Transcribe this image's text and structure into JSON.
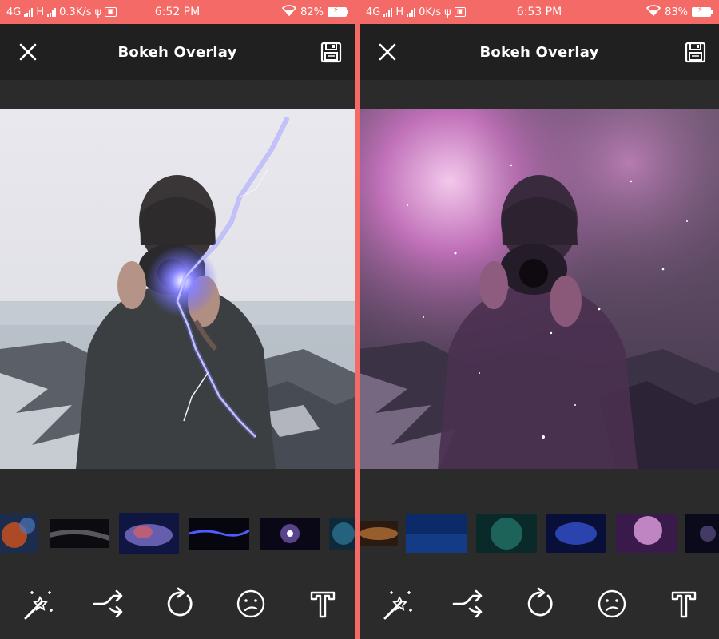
{
  "screens": [
    {
      "status": {
        "net": "4G",
        "net2": "H",
        "speed": "0.3K/s",
        "time": "6:52 PM",
        "battery": "82%"
      },
      "app": {
        "title": "Bokeh Overlay"
      },
      "overlay": "lightning"
    },
    {
      "status": {
        "net": "4G",
        "net2": "H",
        "speed": "0K/s",
        "time": "6:53 PM",
        "battery": "83%"
      },
      "app": {
        "title": "Bokeh Overlay"
      },
      "overlay": "nebula"
    }
  ],
  "thumbnails_left": [
    "orange-nebula",
    "dark-stars",
    "galaxy-blue",
    "blue-streak",
    "purple-galaxy",
    "teal-nebula"
  ],
  "thumbnails_right": [
    "amber-glow",
    "blue-sky-stars",
    "teal-nebula",
    "blue-nebula",
    "pink-nebula",
    "space-dark"
  ],
  "tools": [
    "magic-wand-icon",
    "shuffle-icon",
    "refresh-icon",
    "sad-face-icon",
    "text-icon"
  ],
  "colors": {
    "status_bar": "#f46a66",
    "app_bar": "#202020",
    "background": "#2b2b2b"
  }
}
